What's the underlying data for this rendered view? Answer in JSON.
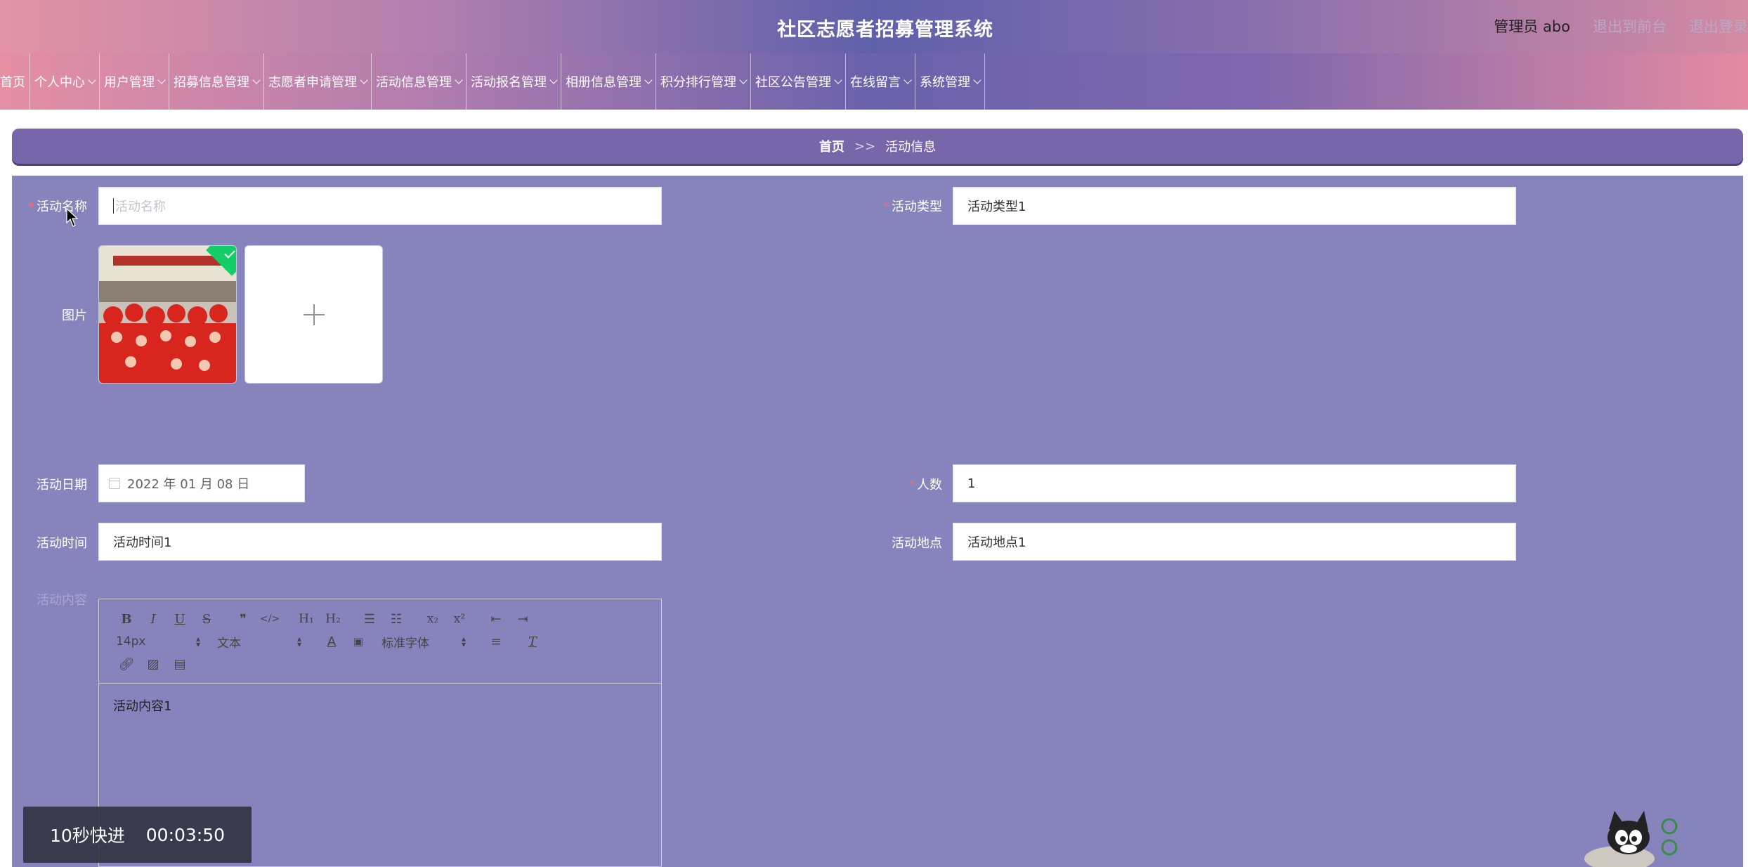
{
  "header": {
    "title": "社区志愿者招募管理系统",
    "user_label": "管理员 abo",
    "exit_front": "退出到前台",
    "logout": "退出登录"
  },
  "nav": {
    "items": [
      {
        "label": "首页",
        "dropdown": false
      },
      {
        "label": "个人中心",
        "dropdown": true
      },
      {
        "label": "用户管理",
        "dropdown": true
      },
      {
        "label": "招募信息管理",
        "dropdown": true
      },
      {
        "label": "志愿者申请管理",
        "dropdown": true
      },
      {
        "label": "活动信息管理",
        "dropdown": true
      },
      {
        "label": "活动报名管理",
        "dropdown": true
      },
      {
        "label": "相册信息管理",
        "dropdown": true
      },
      {
        "label": "积分排行管理",
        "dropdown": true
      },
      {
        "label": "社区公告管理",
        "dropdown": true
      },
      {
        "label": "在线留言",
        "dropdown": true
      },
      {
        "label": "系统管理",
        "dropdown": true
      }
    ]
  },
  "breadcrumb": {
    "home": "首页",
    "separator": ">>",
    "current": "活动信息"
  },
  "form": {
    "activity_name": {
      "label": "活动名称",
      "value": "",
      "placeholder": "活动名称",
      "required": true
    },
    "activity_type": {
      "label": "活动类型",
      "value": "活动类型1",
      "required": true
    },
    "image": {
      "label": "图片"
    },
    "activity_date": {
      "label": "活动日期",
      "value": "2022 年 01 月 08 日"
    },
    "headcount": {
      "label": "人数",
      "value": "1",
      "required": true
    },
    "activity_time": {
      "label": "活动时间",
      "value": "活动时间1"
    },
    "activity_location": {
      "label": "活动地点",
      "value": "活动地点1"
    },
    "activity_content": {
      "label": "活动内容",
      "value": "活动内容1"
    }
  },
  "editor": {
    "font_size": "14px",
    "text_style": "文本",
    "font_family": "标准字体"
  },
  "overlay": {
    "fast_forward": "10秒快进",
    "timestamp": "00:03:50"
  },
  "colors": {
    "panel": "#8784bd",
    "breadcrumb": "#7866aa",
    "required": "#f56c6c",
    "upload_success": "#13ce66"
  }
}
